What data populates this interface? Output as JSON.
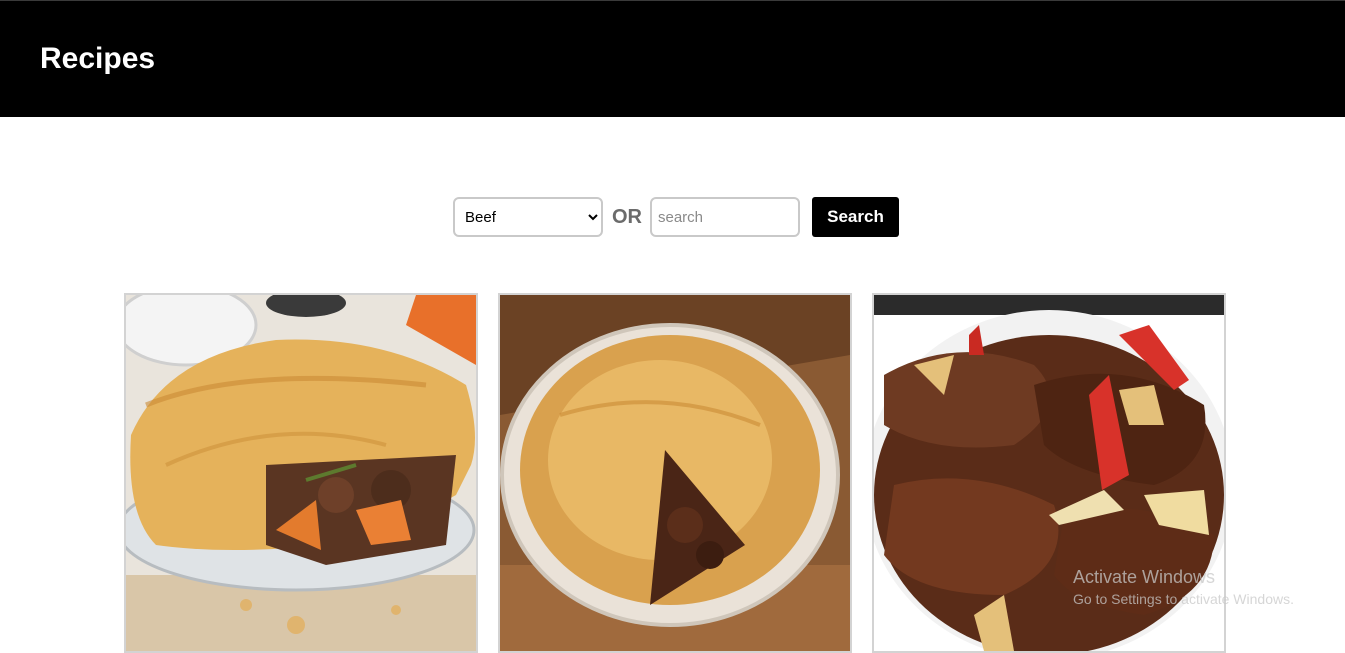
{
  "header": {
    "title": "Recipes"
  },
  "search": {
    "category_selected": "Beef",
    "or_label": "OR",
    "placeholder": "search",
    "value": "",
    "button_label": "Search"
  },
  "recipes": [
    {
      "image": "steak-and-ale-pie-photo"
    },
    {
      "image": "beef-pot-pie-photo"
    },
    {
      "image": "braised-beef-with-peppers-photo"
    }
  ],
  "watermark": {
    "title": "Activate Windows",
    "subtitle": "Go to Settings to activate Windows."
  }
}
